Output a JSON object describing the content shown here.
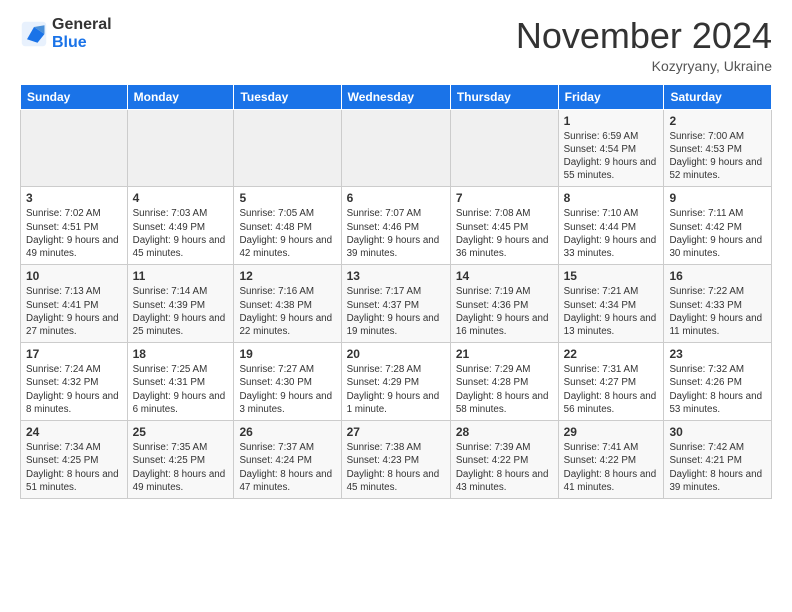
{
  "logo": {
    "general": "General",
    "blue": "Blue"
  },
  "title": "November 2024",
  "location": "Kozyryany, Ukraine",
  "headers": [
    "Sunday",
    "Monday",
    "Tuesday",
    "Wednesday",
    "Thursday",
    "Friday",
    "Saturday"
  ],
  "weeks": [
    [
      {
        "day": "",
        "info": ""
      },
      {
        "day": "",
        "info": ""
      },
      {
        "day": "",
        "info": ""
      },
      {
        "day": "",
        "info": ""
      },
      {
        "day": "",
        "info": ""
      },
      {
        "day": "1",
        "info": "Sunrise: 6:59 AM\nSunset: 4:54 PM\nDaylight: 9 hours and 55 minutes."
      },
      {
        "day": "2",
        "info": "Sunrise: 7:00 AM\nSunset: 4:53 PM\nDaylight: 9 hours and 52 minutes."
      }
    ],
    [
      {
        "day": "3",
        "info": "Sunrise: 7:02 AM\nSunset: 4:51 PM\nDaylight: 9 hours and 49 minutes."
      },
      {
        "day": "4",
        "info": "Sunrise: 7:03 AM\nSunset: 4:49 PM\nDaylight: 9 hours and 45 minutes."
      },
      {
        "day": "5",
        "info": "Sunrise: 7:05 AM\nSunset: 4:48 PM\nDaylight: 9 hours and 42 minutes."
      },
      {
        "day": "6",
        "info": "Sunrise: 7:07 AM\nSunset: 4:46 PM\nDaylight: 9 hours and 39 minutes."
      },
      {
        "day": "7",
        "info": "Sunrise: 7:08 AM\nSunset: 4:45 PM\nDaylight: 9 hours and 36 minutes."
      },
      {
        "day": "8",
        "info": "Sunrise: 7:10 AM\nSunset: 4:44 PM\nDaylight: 9 hours and 33 minutes."
      },
      {
        "day": "9",
        "info": "Sunrise: 7:11 AM\nSunset: 4:42 PM\nDaylight: 9 hours and 30 minutes."
      }
    ],
    [
      {
        "day": "10",
        "info": "Sunrise: 7:13 AM\nSunset: 4:41 PM\nDaylight: 9 hours and 27 minutes."
      },
      {
        "day": "11",
        "info": "Sunrise: 7:14 AM\nSunset: 4:39 PM\nDaylight: 9 hours and 25 minutes."
      },
      {
        "day": "12",
        "info": "Sunrise: 7:16 AM\nSunset: 4:38 PM\nDaylight: 9 hours and 22 minutes."
      },
      {
        "day": "13",
        "info": "Sunrise: 7:17 AM\nSunset: 4:37 PM\nDaylight: 9 hours and 19 minutes."
      },
      {
        "day": "14",
        "info": "Sunrise: 7:19 AM\nSunset: 4:36 PM\nDaylight: 9 hours and 16 minutes."
      },
      {
        "day": "15",
        "info": "Sunrise: 7:21 AM\nSunset: 4:34 PM\nDaylight: 9 hours and 13 minutes."
      },
      {
        "day": "16",
        "info": "Sunrise: 7:22 AM\nSunset: 4:33 PM\nDaylight: 9 hours and 11 minutes."
      }
    ],
    [
      {
        "day": "17",
        "info": "Sunrise: 7:24 AM\nSunset: 4:32 PM\nDaylight: 9 hours and 8 minutes."
      },
      {
        "day": "18",
        "info": "Sunrise: 7:25 AM\nSunset: 4:31 PM\nDaylight: 9 hours and 6 minutes."
      },
      {
        "day": "19",
        "info": "Sunrise: 7:27 AM\nSunset: 4:30 PM\nDaylight: 9 hours and 3 minutes."
      },
      {
        "day": "20",
        "info": "Sunrise: 7:28 AM\nSunset: 4:29 PM\nDaylight: 9 hours and 1 minute."
      },
      {
        "day": "21",
        "info": "Sunrise: 7:29 AM\nSunset: 4:28 PM\nDaylight: 8 hours and 58 minutes."
      },
      {
        "day": "22",
        "info": "Sunrise: 7:31 AM\nSunset: 4:27 PM\nDaylight: 8 hours and 56 minutes."
      },
      {
        "day": "23",
        "info": "Sunrise: 7:32 AM\nSunset: 4:26 PM\nDaylight: 8 hours and 53 minutes."
      }
    ],
    [
      {
        "day": "24",
        "info": "Sunrise: 7:34 AM\nSunset: 4:25 PM\nDaylight: 8 hours and 51 minutes."
      },
      {
        "day": "25",
        "info": "Sunrise: 7:35 AM\nSunset: 4:25 PM\nDaylight: 8 hours and 49 minutes."
      },
      {
        "day": "26",
        "info": "Sunrise: 7:37 AM\nSunset: 4:24 PM\nDaylight: 8 hours and 47 minutes."
      },
      {
        "day": "27",
        "info": "Sunrise: 7:38 AM\nSunset: 4:23 PM\nDaylight: 8 hours and 45 minutes."
      },
      {
        "day": "28",
        "info": "Sunrise: 7:39 AM\nSunset: 4:22 PM\nDaylight: 8 hours and 43 minutes."
      },
      {
        "day": "29",
        "info": "Sunrise: 7:41 AM\nSunset: 4:22 PM\nDaylight: 8 hours and 41 minutes."
      },
      {
        "day": "30",
        "info": "Sunrise: 7:42 AM\nSunset: 4:21 PM\nDaylight: 8 hours and 39 minutes."
      }
    ]
  ]
}
